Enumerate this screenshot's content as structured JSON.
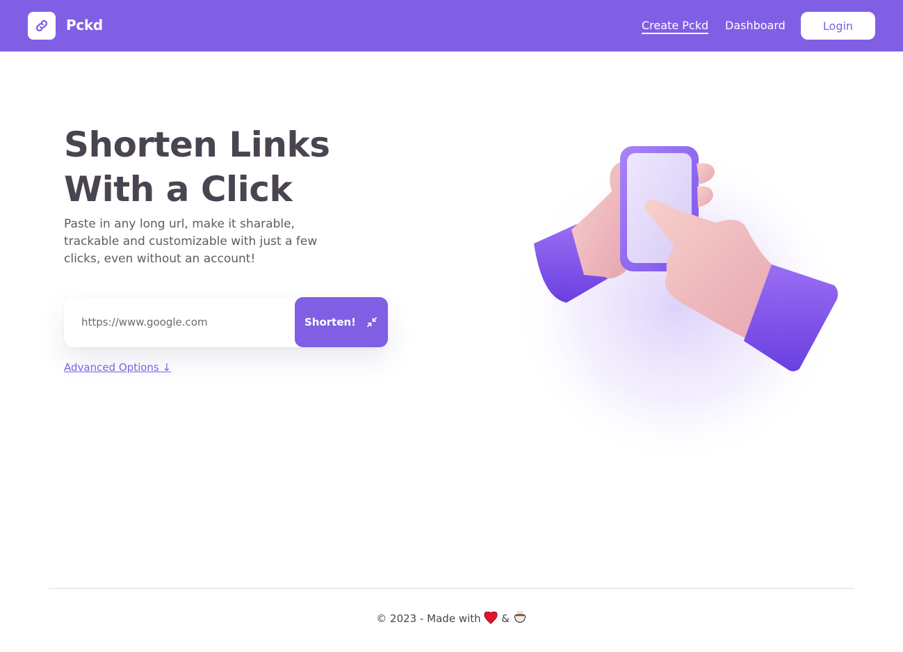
{
  "header": {
    "brand": "Pckd",
    "nav": {
      "create": "Create Pckd",
      "dashboard": "Dashboard",
      "login": "Login"
    },
    "logo_icon": "link-icon"
  },
  "hero": {
    "title_line1": "Shorten Links",
    "title_line2": "With a Click",
    "subtitle": "Paste in any long url, make it sharable, trackable and customizable with just a few clicks, even without an account!",
    "input_placeholder": "https://www.google.com",
    "shorten_label": "Shorten!",
    "shorten_icon": "compress-arrows-icon",
    "advanced_options": "Advanced Options ↓",
    "illustration": "hands-holding-phone-illustration"
  },
  "footer": {
    "copyright_prefix": "© 2023 - Made with",
    "and": "&",
    "icons": [
      "heart-icon",
      "coffee-icon"
    ]
  },
  "colors": {
    "primary": "#805fe4",
    "text": "#4a4450",
    "white": "#ffffff"
  }
}
